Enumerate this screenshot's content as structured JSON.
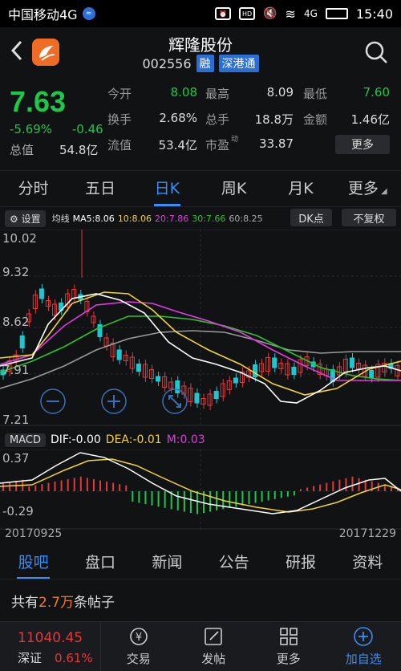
{
  "statusbar": {
    "carrier": "中国移动4G",
    "net_badge": "HD",
    "signal_label": "4G",
    "time": "15:40"
  },
  "header": {
    "name": "辉隆股份",
    "code": "002556",
    "tag_margin": "融",
    "tag_connect": "深港通"
  },
  "quote": {
    "price": "7.63",
    "change_pct": "-5.69%",
    "change": "-0.46",
    "total_cap_label": "总值",
    "total_cap": "54.8亿",
    "cells": [
      {
        "label": "今开",
        "value": "8.08",
        "color": "#1ec74a"
      },
      {
        "label": "最高",
        "value": "8.09",
        "color": "#dddddd"
      },
      {
        "label": "最低",
        "value": "7.60",
        "color": "#1ec74a"
      },
      {
        "label": "换手",
        "value": "2.68%",
        "color": "#dddddd"
      },
      {
        "label": "总手",
        "value": "18.8万",
        "color": "#dddddd"
      },
      {
        "label": "金额",
        "value": "1.46亿",
        "color": "#dddddd"
      },
      {
        "label": "流值",
        "value": "53.4亿",
        "color": "#dddddd"
      },
      {
        "label": "市盈",
        "value": "33.87",
        "color": "#dddddd",
        "sup": "动"
      }
    ],
    "more": "更多"
  },
  "period_tabs": [
    "分时",
    "五日",
    "日K",
    "周K",
    "月K",
    "更多"
  ],
  "ma_bar": {
    "settings": "设置",
    "label": "均线",
    "ma5": "MA5:8.06",
    "ma10": "10:8.06",
    "ma20": "20:7.86",
    "ma30": "30:7.66",
    "ma60": "60:8.25",
    "dk": "DK点",
    "fq": "不复权"
  },
  "kline": {
    "ylabels": [
      "10.02",
      "9.32",
      "8.62",
      "7.91",
      "7.21"
    ],
    "ymax": 10.02,
    "ymin": 7.21
  },
  "macd": {
    "tag": "MACD",
    "dif": "DIF:-0.00",
    "dea": "DEA:-0.01",
    "m": "M:0.03",
    "ymax": "0.37",
    "ymin": "-0.29"
  },
  "dates": {
    "start": "20170925",
    "end": "20171229"
  },
  "bottom_tabs": [
    "股吧",
    "盘口",
    "新闻",
    "公告",
    "研报",
    "资料"
  ],
  "posts": {
    "prefix": "共有",
    "count": "2.7万",
    "suffix": "条帖子"
  },
  "bottom_bar": {
    "index_value": "11040.45",
    "index_name": "深证",
    "index_change": "0.61%",
    "nav": [
      "交易",
      "发帖",
      "更多",
      "加自选"
    ]
  },
  "colors": {
    "up": "#e03b3b",
    "down": "#1ec7d0",
    "green": "#1ec74a",
    "accent": "#3b8cf5"
  }
}
